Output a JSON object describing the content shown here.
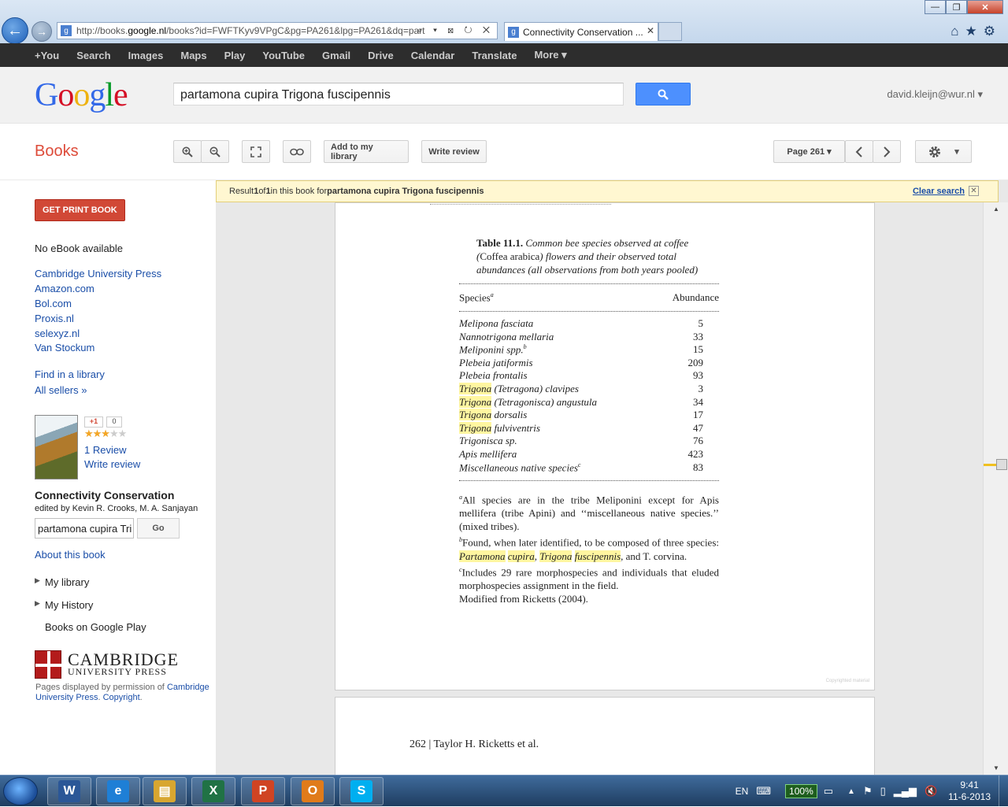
{
  "browser": {
    "address_url_prefix": "http://books.",
    "address_url_domain": "google.nl",
    "address_url_rest": "/books?id=FWFTKyv9VPgC&pg=PA261&lpg=PA261&dq=part",
    "tab_title": "Connectivity Conservation ...",
    "address_tools": "⌕ ▾ ⊠ ↻ ✕",
    "tab_close": "✕",
    "back_glyph": "←",
    "forward_glyph": "→",
    "favicon_letter": "g",
    "win_minimize": "—",
    "win_maximize": "❐",
    "win_close": "✕",
    "toolbar_icons": "⌂★⚙"
  },
  "gbar": {
    "items": [
      "+You",
      "Search",
      "Images",
      "Maps",
      "Play",
      "YouTube",
      "Gmail",
      "Drive",
      "Calendar",
      "Translate",
      "More ▾"
    ]
  },
  "header": {
    "logo_letters": [
      "G",
      "o",
      "o",
      "g",
      "l",
      "e"
    ],
    "search_value": "partamona cupira Trigona fuscipennis",
    "user": "david.kleijn@wur.nl ▾"
  },
  "books_bar": {
    "title": "Books",
    "add_library": "Add to my library",
    "write_review": "Write review",
    "page_select": "Page 261 ▾",
    "settings_arrow": "▾"
  },
  "sidebar": {
    "print_button": "GET PRINT BOOK",
    "no_ebook": "No eBook available",
    "sellers": [
      "Cambridge University Press",
      "Amazon.com",
      "Bol.com",
      "Proxis.nl",
      "selexyz.nl",
      "Van Stockum"
    ],
    "find_library": "Find in a library",
    "all_sellers": "All sellers »",
    "plusone": "+1",
    "plusone_count": "0",
    "rating_stars": 3,
    "stars": "★★★★★",
    "review_count": "1 Review",
    "write_review": "Write review",
    "book_title": "Connectivity Conservation",
    "editors": "edited by Kevin R. Crooks, M. A. Sanjayan",
    "search_in_book": "partamona cupira Tri",
    "go_button": "Go",
    "about": "About this book",
    "my_library": "My library",
    "my_history": "My History",
    "books_on_play": "Books on Google Play",
    "publisher_name": "CAMBRIDGE",
    "publisher_sub": "UNIVERSITY PRESS",
    "permission_prefix": "Pages displayed by permission of ",
    "permission_link": "Cambridge University Press",
    "copyright": "Copyright"
  },
  "viewer": {
    "result_prefix": "Result ",
    "result_n": "1",
    "result_of": " of ",
    "result_total": "1",
    "result_mid": " in this book for ",
    "result_query": "partamona cupira Trigona fuscipennis",
    "clear_search": "Clear search",
    "page261": {
      "caption_label": "Table 11.1.",
      "caption_text_a": "Common bee species observed at coffee (",
      "caption_coffea": "Coffea arabica",
      "caption_text_b": ") flowers and their observed total abundances (all observations from both years pooled)",
      "col_species": "Species",
      "col_species_sup": "a",
      "col_abundance": "Abundance",
      "rows": [
        {
          "hl": "",
          "rest": "Melipona fasciata",
          "sup": "",
          "value": "5"
        },
        {
          "hl": "",
          "rest": "Nannotrigona mellaria",
          "sup": "",
          "value": "33"
        },
        {
          "hl": "",
          "rest": "Meliponini spp.",
          "sup": "b",
          "value": "15"
        },
        {
          "hl": "",
          "rest": "Plebeia jatiformis",
          "sup": "",
          "value": "209"
        },
        {
          "hl": "",
          "rest": "Plebeia frontalis",
          "sup": "",
          "value": "93"
        },
        {
          "hl": "Trigona",
          "rest": " (Tetragona) clavipes",
          "sup": "",
          "value": "3"
        },
        {
          "hl": "Trigona",
          "rest": " (Tetragonisca) angustula",
          "sup": "",
          "value": "34"
        },
        {
          "hl": "Trigona",
          "rest": " dorsalis",
          "sup": "",
          "value": "17"
        },
        {
          "hl": "Trigona",
          "rest": " fulviventris",
          "sup": "",
          "value": "47"
        },
        {
          "hl": "",
          "rest": "Trigonisca sp.",
          "sup": "",
          "value": "76"
        },
        {
          "hl": "",
          "rest": "Apis mellifera",
          "sup": "",
          "value": "423"
        },
        {
          "hl": "",
          "rest": "Miscellaneous native species",
          "sup": "c",
          "value": "83"
        }
      ],
      "fn_a": "All species are in the tribe Meliponini except for Apis mellifera (tribe Apini) and ‘‘miscellaneous native species.’’ (mixed tribes).",
      "fn_b_pre": "Found, when later identified, to be composed of three species: ",
      "fn_b_hl1": "Partamona",
      "fn_b_hl2": "cupira",
      "fn_b_hl3": "Trigona",
      "fn_b_hl4": "fuscipennis",
      "fn_b_post": ", and T. corvina.",
      "fn_c": "Includes 29 rare morphospecies and individuals that eluded morphospecies assignment in the field.",
      "modified": "Modified from Ricketts (2004).",
      "copyrighted": "Copyrighted material"
    },
    "page262": {
      "header": "262 | Taylor H. Ricketts et al."
    }
  },
  "taskbar": {
    "lang": "EN",
    "battery": "100%",
    "time": "9:41",
    "date": "11-6-2013",
    "tray_arrow": "▲",
    "apps": [
      {
        "letter": "W",
        "color": "#2b5797"
      },
      {
        "letter": "e",
        "color": "#1e7fd6"
      },
      {
        "letter": "▤",
        "color": "#d8a630"
      },
      {
        "letter": "X",
        "color": "#207245"
      },
      {
        "letter": "P",
        "color": "#d04423"
      },
      {
        "letter": "O",
        "color": "#e07b1a"
      },
      {
        "letter": "S",
        "color": "#00aff0"
      }
    ]
  }
}
